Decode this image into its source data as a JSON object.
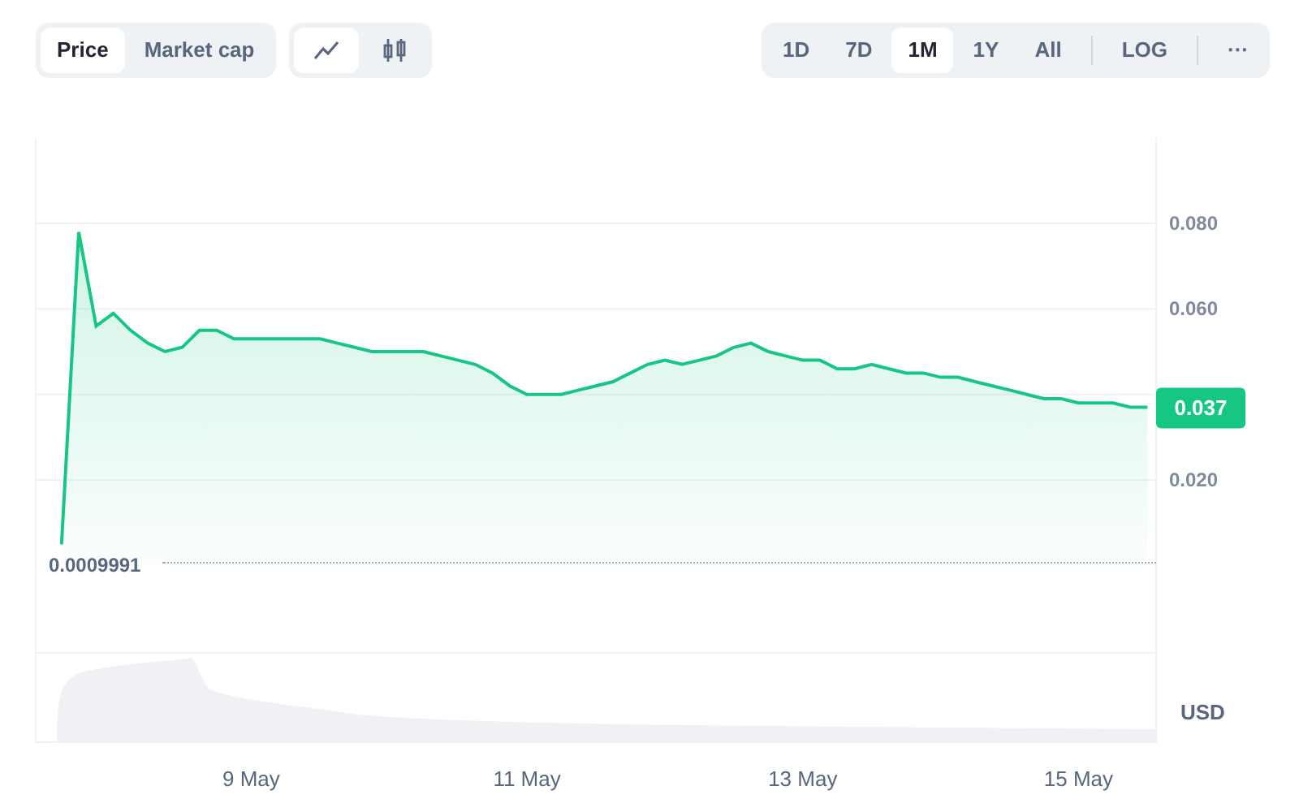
{
  "metric_tabs": [
    {
      "label": "Price",
      "selected": true
    },
    {
      "label": "Market cap",
      "selected": false
    }
  ],
  "chart_types": [
    {
      "kind": "line",
      "selected": true
    },
    {
      "kind": "candlestick",
      "selected": false
    }
  ],
  "ranges": [
    {
      "label": "1D",
      "selected": false
    },
    {
      "label": "7D",
      "selected": false
    },
    {
      "label": "1M",
      "selected": true
    },
    {
      "label": "1Y",
      "selected": false
    },
    {
      "label": "All",
      "selected": false
    }
  ],
  "scale_button": {
    "label": "LOG"
  },
  "more_button": {
    "label": "···"
  },
  "chart": {
    "current_price": "0.037",
    "low_label": "0.0009991",
    "currency": "USD",
    "chart_data": {
      "type": "area",
      "categories": [
        null,
        null,
        null,
        null,
        null,
        null,
        null,
        null,
        null,
        null,
        null,
        null,
        "9 May",
        null,
        null,
        null,
        null,
        null,
        null,
        null,
        null,
        null,
        null,
        null,
        null,
        null,
        null,
        null,
        "11 May",
        null,
        null,
        null,
        null,
        null,
        null,
        null,
        null,
        null,
        null,
        null,
        null,
        null,
        null,
        null,
        "13 May",
        null,
        null,
        null,
        null,
        null,
        null,
        null,
        null,
        null,
        null,
        null,
        null,
        null,
        null,
        null,
        "15 May",
        null,
        null,
        null,
        null
      ],
      "series": [
        {
          "color": "#16c784",
          "values": [
            null,
            0.0049,
            0.078,
            0.056,
            0.059,
            0.055,
            0.052,
            0.05,
            0.051,
            0.055,
            0.055,
            0.053,
            0.053,
            0.053,
            0.053,
            0.053,
            0.053,
            0.052,
            0.051,
            0.05,
            0.05,
            0.05,
            0.05,
            0.049,
            0.048,
            0.047,
            0.045,
            0.042,
            0.04,
            0.04,
            0.04,
            0.041,
            0.042,
            0.043,
            0.045,
            0.047,
            0.048,
            0.047,
            0.048,
            0.049,
            0.051,
            0.052,
            0.05,
            0.049,
            0.048,
            0.048,
            0.046,
            0.046,
            0.047,
            0.046,
            0.045,
            0.045,
            0.044,
            0.044,
            0.043,
            0.042,
            0.041,
            0.04,
            0.039,
            0.039,
            0.038,
            0.038,
            0.038,
            0.037,
            0.037
          ]
        }
      ],
      "ylim": [
        -0.0414,
        0.1
      ],
      "grid": true,
      "yticks": [
        {
          "value": 0.02,
          "label": "0.020"
        },
        {
          "value": 0.06,
          "label": "0.060"
        },
        {
          "value": 0.08,
          "label": "0.080"
        }
      ]
    }
  }
}
